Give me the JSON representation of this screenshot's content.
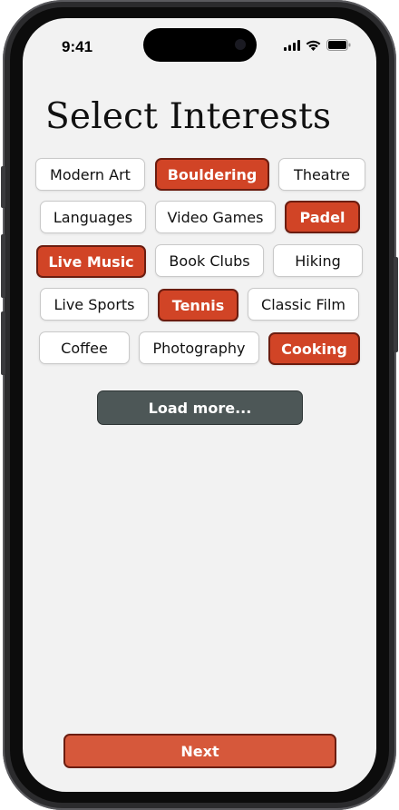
{
  "status_bar": {
    "time": "9:41"
  },
  "page": {
    "title": "Select Interests"
  },
  "interests": [
    {
      "label": "Modern Art",
      "selected": false
    },
    {
      "label": "Bouldering",
      "selected": true
    },
    {
      "label": "Theatre",
      "selected": false
    },
    {
      "label": "Languages",
      "selected": false
    },
    {
      "label": "Video Games",
      "selected": false
    },
    {
      "label": "Padel",
      "selected": true
    },
    {
      "label": "Live Music",
      "selected": true
    },
    {
      "label": "Book Clubs",
      "selected": false
    },
    {
      "label": "Hiking",
      "selected": false
    },
    {
      "label": "Live Sports",
      "selected": false
    },
    {
      "label": "Tennis",
      "selected": true
    },
    {
      "label": "Classic Film",
      "selected": false
    },
    {
      "label": "Coffee",
      "selected": false
    },
    {
      "label": "Photography",
      "selected": false
    },
    {
      "label": "Cooking",
      "selected": true
    }
  ],
  "actions": {
    "load_more_label": "Load more...",
    "next_label": "Next"
  },
  "colors": {
    "accent": "#d14426",
    "accent_border": "#6b1d10",
    "load_more_bg": "#4d5757",
    "screen_bg": "#f2f2f2"
  },
  "icons": [
    "signal-icon",
    "wifi-icon",
    "battery-icon"
  ]
}
